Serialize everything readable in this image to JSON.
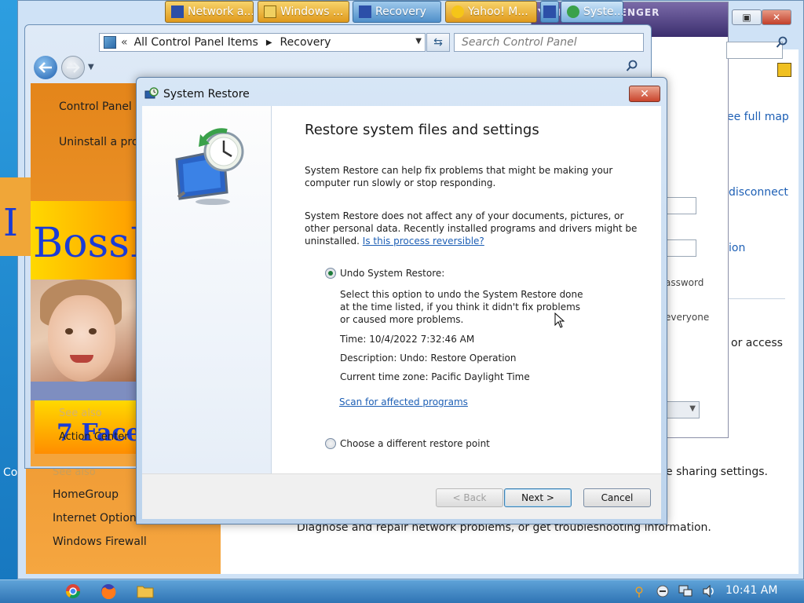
{
  "desktop": {
    "partial_text": "Co"
  },
  "back_window": {
    "right_texts": {
      "see_full_map": "ee full map",
      "disconnect": "disconnect",
      "ion": "ion",
      "password": "assword",
      "everyone": "everyone",
      "or_access": "or access",
      "sharing_settings": "e sharing settings.",
      "diagnose": "Diagnose and repair network problems, or get troubleshooting information."
    },
    "left_links": [
      "HomeGroup",
      "Internet Options",
      "Windows Firewall"
    ],
    "see_also_partial": "See also"
  },
  "yahoo": {
    "title": "YAHOO! MESSENGER"
  },
  "control_panel": {
    "breadcrumb": [
      "All Control Panel Items",
      "Recovery"
    ],
    "breadcrumb_prefix": "«",
    "search_placeholder": "Search Control Panel",
    "left_links": [
      "Control Panel h",
      "Uninstall a proc"
    ],
    "see_also": "See also",
    "action_center": "Action Center",
    "bossk_text": "BossK",
    "seven_text": "7 Facel"
  },
  "system_restore": {
    "title": "System Restore",
    "heading": "Restore system files and settings",
    "para1": "System Restore can help fix problems that might be making your computer run slowly or stop responding.",
    "para2": "System Restore does not affect any of your documents, pictures, or other personal data. Recently installed programs and drivers might be uninstalled.",
    "reversible_link": "Is this process reversible?",
    "option_undo": "Undo System Restore:",
    "undo_desc": "Select this option to undo the System Restore done at the time listed, if you think it didn't fix problems or caused more problems.",
    "time_line": "Time: 10/4/2022 7:32:46 AM",
    "description_line": "Description: Undo: Restore Operation",
    "timezone_line": "Current time zone: Pacific Daylight Time",
    "scan_link": "Scan for affected programs",
    "option_other": "Choose a different restore point",
    "buttons": {
      "back": "< Back",
      "next": "Next >",
      "cancel": "Cancel"
    }
  },
  "taskbar": {
    "buttons": [
      "Network a...",
      "Windows ...",
      "Recovery",
      "Yahoo! M...",
      "Syste..."
    ],
    "clock": "10:41 AM"
  },
  "colors": {
    "desktop": "#2d9ee0",
    "taskbar": "#2f74b4",
    "link": "#1d5fb5",
    "orange_panel": "#e4851a",
    "close_red": "#c9442c"
  },
  "icons": [
    "back-arrow-icon",
    "forward-arrow-icon",
    "search-icon",
    "refresh-icon",
    "system-restore-icon",
    "chrome-icon",
    "firefox-icon",
    "folder-icon",
    "speaker-icon",
    "network-icon"
  ]
}
